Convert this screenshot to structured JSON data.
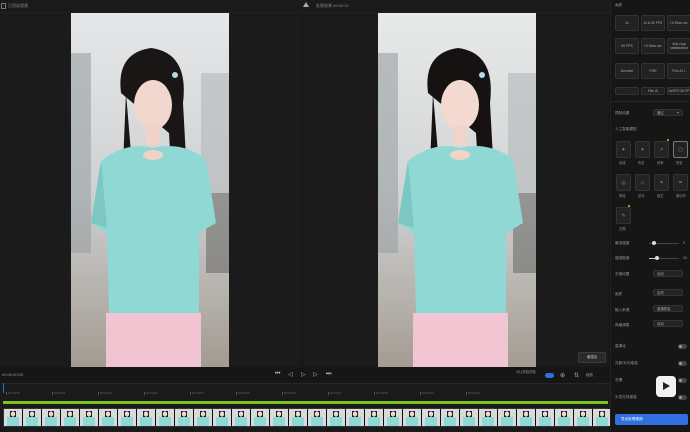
{
  "left_panel": {
    "title": "已渲染视频"
  },
  "right_panel": {
    "title": "处理效果",
    "subtitle": "00:00:10"
  },
  "right_panel_button": {
    "label": "增强后"
  },
  "mode_buttons": [
    "AI",
    "AI & 60 FPS",
    "Hi Slow mo",
    "60 FPS",
    "Hi Slow mo",
    "Anti-crop stabilization",
    "Denoise",
    "FHD",
    "Film AI L",
    "",
    "Film AI",
    "AI/GFX 60 FP"
  ],
  "sidebar": {
    "top_label": "画质",
    "preset_label": "预制设置",
    "preset_value": "通过",
    "section_title": "人工智能模型",
    "model_icons": [
      "增强",
      "恢复",
      "帧率",
      "修复",
      "降噪",
      "锐化",
      "稳定",
      "慢动作",
      "去隔"
    ],
    "strength_label": "最低强度",
    "strength_value": "0",
    "sharp_label": "增强程度",
    "sharp_value": "20",
    "r1_label": "去噪设置",
    "r1_value": "自动",
    "r2_label": "画质",
    "r2_value": "自然",
    "r3_label": "输入来源",
    "r3_value": "普通质量",
    "r4_label": "风格调整",
    "r4_value": "自动",
    "t1_label": "高清化",
    "t2_label": "光影/补光增强",
    "t3_label": "去隔",
    "t4_label": "头发光效增强",
    "export_label": "导出处理视频"
  },
  "timeline": {
    "time": "00:00:00:00",
    "compare_label": "对比原始视频",
    "zoom_label": "缩放",
    "tick_labels": [
      "00:00:00",
      "00:00:01",
      "00:00:02",
      "00:00:03",
      "00:00:04",
      "00:00:05",
      "00:00:06",
      "00:00:07",
      "00:00:08",
      "00:00:09",
      "00:00:10"
    ]
  },
  "colors": {
    "accent": "#2f6fe0",
    "shirt": "#8fd8d4",
    "clip_bar": "#7fc11f"
  }
}
